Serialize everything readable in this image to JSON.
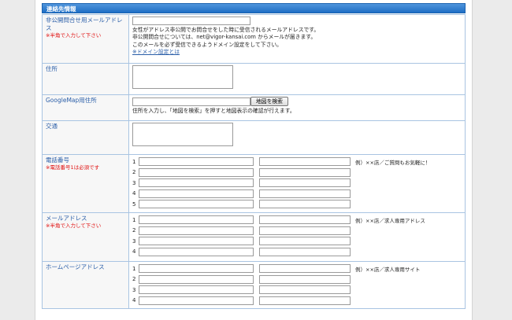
{
  "section_title": "連絡先情報",
  "private_email": {
    "label": "非公開問合せ用メールアドレス",
    "note": "※半角で入力して下さい",
    "value": "",
    "desc1": "女性がアドレス非公開でお問合せをした時に受信されるメールアドレスです。",
    "desc2": "非公開問合せについては、net@vigor-kansai.com からメールが届きます。",
    "desc3": "このメールを必ず受信できるようドメイン設定をして下さい。",
    "link": "※ドメイン設定とは"
  },
  "address": {
    "label": "住所",
    "value": ""
  },
  "googlemap": {
    "label": "GoogleMap用住所",
    "value": "",
    "button": "地図を検索",
    "desc": "住所を入力し、「地図を検索」を押すと地図表示の確認が行えます。"
  },
  "transport": {
    "label": "交通",
    "value": ""
  },
  "phone": {
    "label": "電話番号",
    "note": "※電話番号1は必須です",
    "hint": "例）××店／ご質問もお気軽に！",
    "rows": [
      "1",
      "2",
      "3",
      "4",
      "5"
    ]
  },
  "mail": {
    "label": "メールアドレス",
    "note": "※半角で入力して下さい",
    "hint": "例）××店／求人専用アドレス",
    "rows": [
      "1",
      "2",
      "3",
      "4"
    ]
  },
  "homepage": {
    "label": "ホームページアドレス",
    "hint": "例）××店／求人専用サイト",
    "rows": [
      "1",
      "2",
      "3",
      "4"
    ]
  }
}
